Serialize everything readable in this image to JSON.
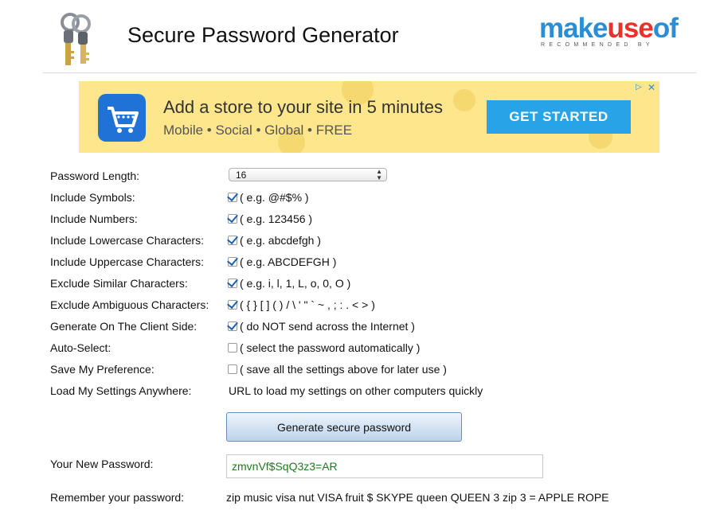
{
  "header": {
    "title": "Secure Password Generator",
    "logo_text_1": "make",
    "logo_text_2": "use",
    "logo_text_3": "of",
    "logo_sub": "RECOMMENDED BY"
  },
  "ad": {
    "headline": "Add a store to your site in 5 minutes",
    "subline": "Mobile  •  Social  •  Global  •  FREE",
    "cta": "GET STARTED",
    "choices_icon": "adchoices-icon",
    "close_icon": "close-icon"
  },
  "form": {
    "length_label": "Password Length:",
    "length_value": "16",
    "rows": [
      {
        "label": "Include Symbols:",
        "checked": true,
        "hint": "( e.g. @#$% )"
      },
      {
        "label": "Include Numbers:",
        "checked": true,
        "hint": "( e.g. 123456 )"
      },
      {
        "label": "Include Lowercase Characters:",
        "checked": true,
        "hint": "( e.g. abcdefgh )"
      },
      {
        "label": "Include Uppercase Characters:",
        "checked": true,
        "hint": "( e.g. ABCDEFGH )"
      },
      {
        "label": "Exclude Similar Characters:",
        "checked": true,
        "hint": "( e.g. i, l, 1, L, o, 0, O )"
      },
      {
        "label": "Exclude Ambiguous Characters:",
        "checked": true,
        "hint": "( { } [ ] ( ) / \\ ' \" ` ~ , ; : . < > )"
      },
      {
        "label": "Generate On The Client Side:",
        "checked": true,
        "hint": "( do NOT send across the Internet )"
      },
      {
        "label": "Auto-Select:",
        "checked": false,
        "hint": "( select the password automatically )"
      },
      {
        "label": "Save My Preference:",
        "checked": false,
        "hint": "( save all the settings above for later use )"
      }
    ],
    "load_label": "Load My Settings Anywhere:",
    "load_link": "URL to load my settings on other computers quickly",
    "generate_button": "Generate secure password",
    "new_password_label": "Your New Password:",
    "new_password_value": "zmvnVf$SqQ3z3=AR",
    "remember_label": "Remember your password:",
    "remember_value": "zip music visa nut VISA fruit $ SKYPE queen QUEEN 3 zip 3 = APPLE ROPE"
  },
  "colors": {
    "password_text": "#1d7a1d",
    "ad_background": "#fde68c",
    "ad_button": "#27a4e8",
    "checkbox_check": "#1a5fb4"
  }
}
